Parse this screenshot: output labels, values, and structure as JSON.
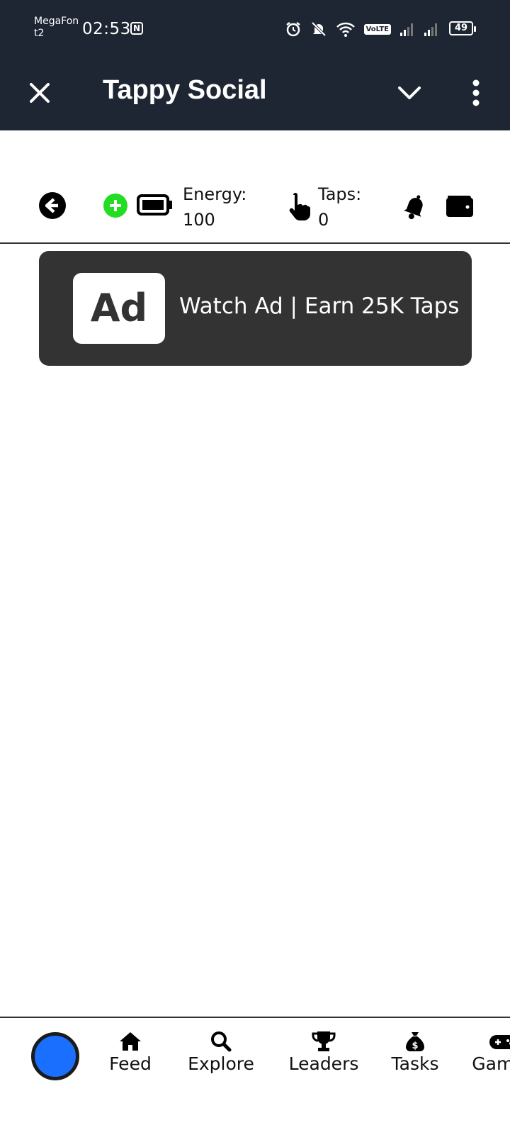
{
  "status_bar": {
    "carrier_line1": "MegaFon",
    "carrier_line2": "t2",
    "time": "02:53",
    "volte": "VoLTE",
    "battery": "49"
  },
  "app_bar": {
    "title": "Tappy Social"
  },
  "stats": {
    "energy_label": "Energy:",
    "energy_value": "100",
    "taps_label": "Taps:",
    "taps_value": "0"
  },
  "ad_banner": {
    "logo_text": "Ad",
    "text": "Watch Ad | Earn 25K Taps"
  },
  "bottom_nav": {
    "items": [
      {
        "label": "Feed",
        "icon": "home-icon"
      },
      {
        "label": "Explore",
        "icon": "search-icon"
      },
      {
        "label": "Leaders",
        "icon": "trophy-icon"
      },
      {
        "label": "Tasks",
        "icon": "money-bag-icon"
      },
      {
        "label": "Games",
        "icon": "gamepad-icon"
      }
    ]
  },
  "colors": {
    "header_bg": "#1f2633",
    "banner_bg": "#333333",
    "add_energy": "#22dd22",
    "avatar": "#1a6fff"
  }
}
